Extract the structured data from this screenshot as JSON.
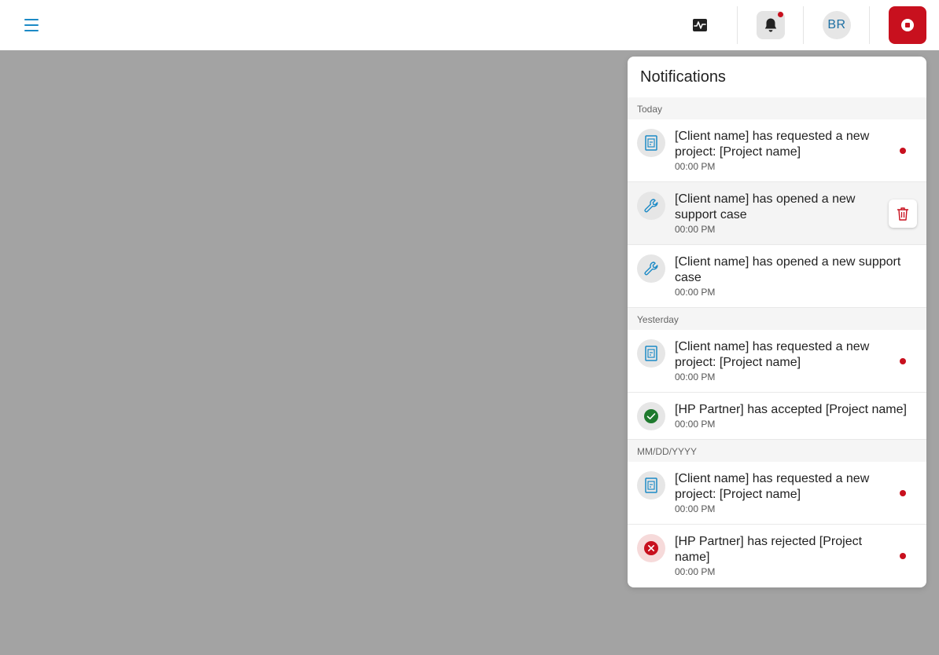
{
  "topbar": {
    "avatar_initials": "BR"
  },
  "notifications": {
    "title": "Notifications",
    "groups": [
      {
        "label": "Today",
        "items": [
          {
            "icon": "project-icon",
            "text": "[Client name] has requested a new project: [Project name]",
            "time": "00:00 PM",
            "unread": true
          },
          {
            "icon": "wrench-icon",
            "text": "[Client name] has opened a new support case",
            "time": "00:00 PM",
            "unread": false,
            "hovered": true
          },
          {
            "icon": "wrench-icon",
            "text": "[Client name] has opened a new support case",
            "time": "00:00 PM",
            "unread": false
          }
        ]
      },
      {
        "label": "Yesterday",
        "items": [
          {
            "icon": "project-icon",
            "text": "[Client name] has requested a new project: [Project name]",
            "time": "00:00 PM",
            "unread": true
          },
          {
            "icon": "check-circle-icon",
            "text": "[HP Partner] has accepted [Project name]",
            "time": "00:00 PM",
            "unread": false
          }
        ]
      },
      {
        "label": "MM/DD/YYYY",
        "items": [
          {
            "icon": "project-icon",
            "text": "[Client name] has requested a new project: [Project name]",
            "time": "00:00 PM",
            "unread": true
          },
          {
            "icon": "x-circle-icon",
            "text": "[HP Partner] has rejected [Project name]",
            "time": "00:00 PM",
            "unread": true
          }
        ]
      }
    ]
  },
  "colors": {
    "accent_blue": "#1c8ac6",
    "brand_red": "#c8101e",
    "success_green": "#1f7a2e",
    "overlay_gray": "#a3a3a3"
  }
}
